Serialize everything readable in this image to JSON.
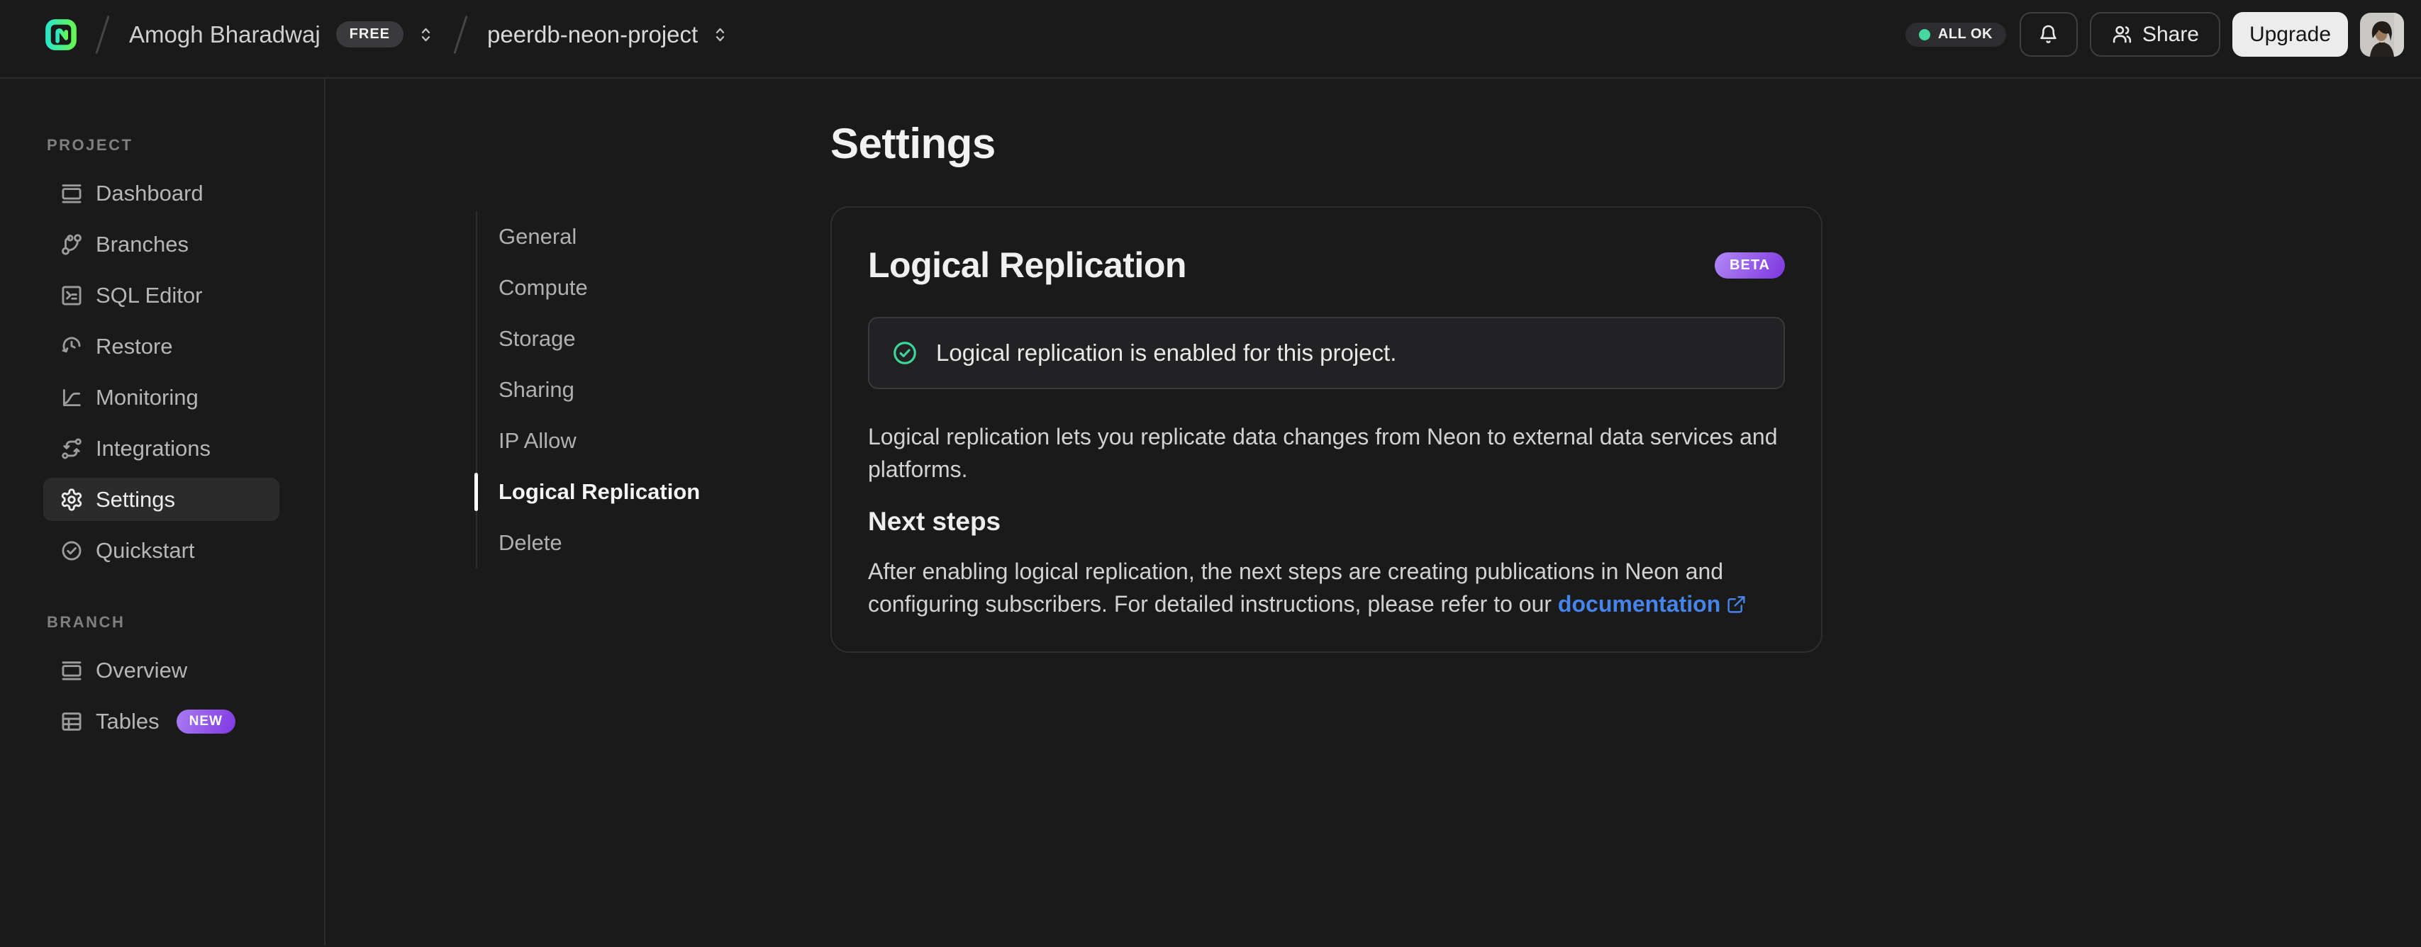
{
  "header": {
    "breadcrumb": {
      "org_name": "Amogh Bharadwaj",
      "org_plan_badge": "FREE",
      "project_name": "peerdb-neon-project"
    },
    "status_badge": "ALL OK",
    "share_label": "Share",
    "upgrade_label": "Upgrade"
  },
  "sidebar": {
    "project_section_label": "PROJECT",
    "project_items": [
      {
        "label": "Dashboard",
        "icon": "dashboard-icon",
        "active": false
      },
      {
        "label": "Branches",
        "icon": "branches-icon",
        "active": false
      },
      {
        "label": "SQL Editor",
        "icon": "sql-editor-icon",
        "active": false
      },
      {
        "label": "Restore",
        "icon": "restore-icon",
        "active": false
      },
      {
        "label": "Monitoring",
        "icon": "monitoring-icon",
        "active": false
      },
      {
        "label": "Integrations",
        "icon": "integrations-icon",
        "active": false
      },
      {
        "label": "Settings",
        "icon": "gear-icon",
        "active": true
      },
      {
        "label": "Quickstart",
        "icon": "quickstart-icon",
        "active": false
      }
    ],
    "branch_section_label": "BRANCH",
    "branch_items": [
      {
        "label": "Overview",
        "icon": "overview-icon",
        "active": false
      },
      {
        "label": "Tables",
        "icon": "tables-icon",
        "badge": "NEW",
        "active": false
      }
    ]
  },
  "settings_nav": {
    "items": [
      {
        "label": "General",
        "active": false
      },
      {
        "label": "Compute",
        "active": false
      },
      {
        "label": "Storage",
        "active": false
      },
      {
        "label": "Sharing",
        "active": false
      },
      {
        "label": "IP Allow",
        "active": false
      },
      {
        "label": "Logical Replication",
        "active": true
      },
      {
        "label": "Delete",
        "active": false
      }
    ]
  },
  "main": {
    "page_title": "Settings",
    "card": {
      "title": "Logical Replication",
      "beta_badge": "BETA",
      "alert_text": "Logical replication is enabled for this project.",
      "description": "Logical replication lets you replicate data changes from Neon to external data services and platforms.",
      "next_steps_title": "Next steps",
      "next_steps_text_before": "After enabling logical replication, the next steps are creating publications in Neon and configuring subscribers. For detailed instructions, please refer to our ",
      "link_label": "documentation"
    }
  },
  "colors": {
    "background": "#1a1a1a",
    "border": "#2c2c2e",
    "accent_green": "#45d9a1",
    "badge_purple_start": "#a97cf3",
    "badge_purple_end": "#8038e2",
    "link_blue": "#4584ea",
    "upgrade_button_bg": "#ececec",
    "logo_gradient_start": "#2de6c4",
    "logo_gradient_end": "#63f655"
  }
}
